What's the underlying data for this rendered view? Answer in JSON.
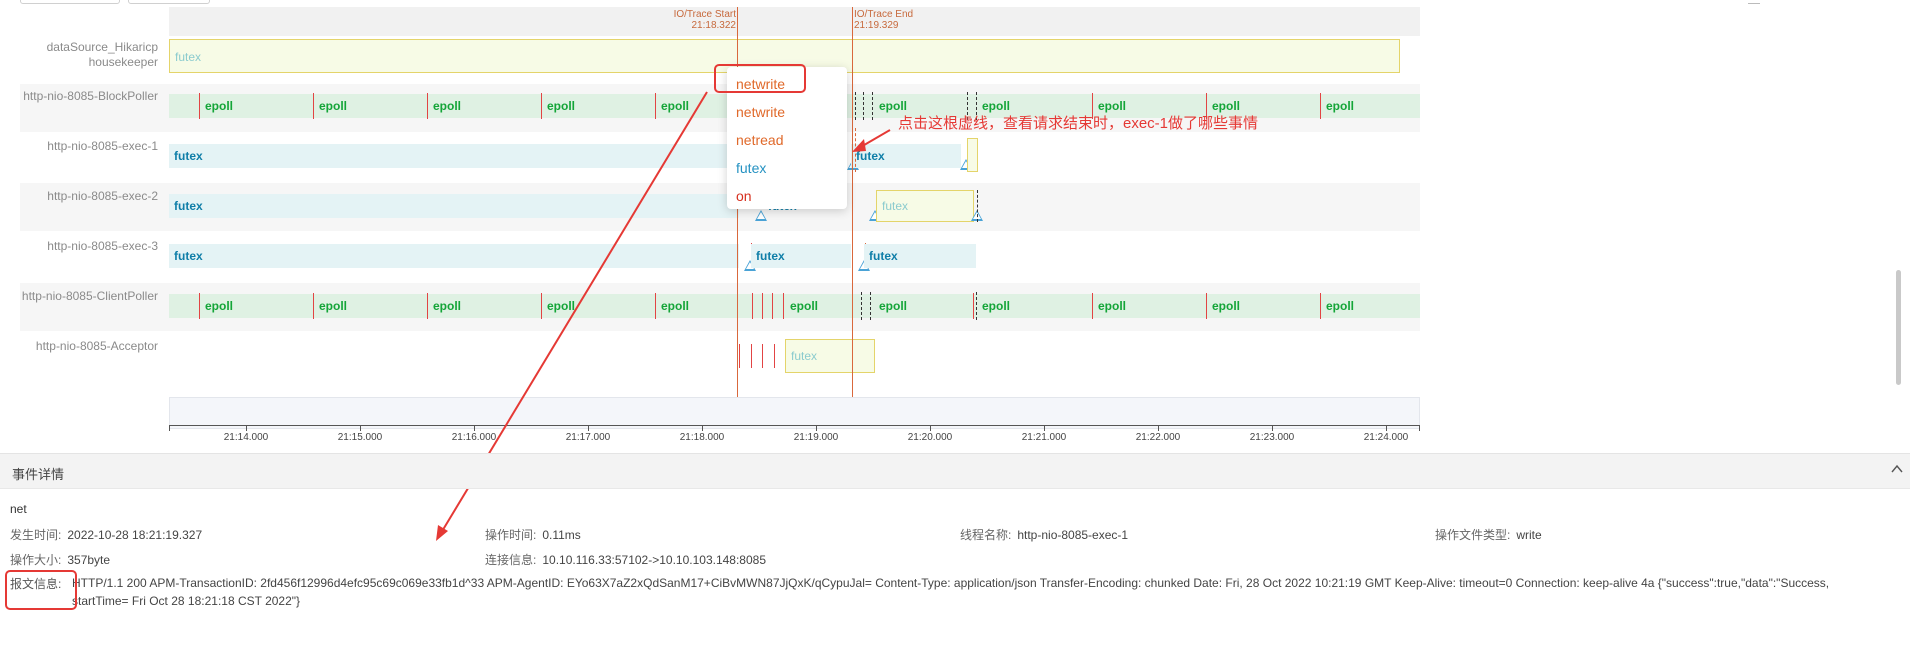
{
  "trace": {
    "start_label": "IO/Trace Start",
    "start_time": "21:18.322",
    "end_label": "IO/Trace End",
    "end_time": "21:19.329"
  },
  "rows": [
    {
      "label": "dataSource_Hikaricp housekeeper",
      "bar_text": "futex"
    },
    {
      "label": "http-nio-8085-BlockPoller",
      "bar_text": "epoll"
    },
    {
      "label": "http-nio-8085-exec-1",
      "bar_text": "futex"
    },
    {
      "label": "http-nio-8085-exec-2",
      "bar_text": "futex"
    },
    {
      "label": "http-nio-8085-exec-3",
      "bar_text": "futex"
    },
    {
      "label": "http-nio-8085-ClientPoller",
      "bar_text": "epoll"
    },
    {
      "label": "http-nio-8085-Acceptor",
      "bar_text": "futex"
    }
  ],
  "dropdown": {
    "items": [
      {
        "label": "netwrite",
        "color": "#e0692a"
      },
      {
        "label": "netwrite",
        "color": "#e0692a"
      },
      {
        "label": "netread",
        "color": "#e0692a"
      },
      {
        "label": "futex",
        "color": "#2592c2"
      },
      {
        "label": "on",
        "color": "#d62f1e"
      }
    ]
  },
  "annotation": "点击这根虚线，查看请求结束时，exec-1做了哪些事情",
  "axis_ticks": [
    "21:14.000",
    "21:15.000",
    "21:16.000",
    "21:17.000",
    "21:18.000",
    "21:19.000",
    "21:20.000",
    "21:21.000",
    "21:22.000",
    "21:23.000",
    "21:24.000"
  ],
  "details": {
    "title": "事件详情",
    "event_type": "net",
    "occur_time_label": "发生时间:",
    "occur_time": "2022-10-28 18:21:19.327",
    "op_time_label": "操作时间:",
    "op_time": "0.11ms",
    "thread_label": "线程名称:",
    "thread": "http-nio-8085-exec-1",
    "file_type_label": "操作文件类型:",
    "file_type": "write",
    "size_label": "操作大小:",
    "size": "357byte",
    "conn_label": "连接信息:",
    "conn": "10.10.116.33:57102->10.10.103.148:8085",
    "msg_label": "报文信息:",
    "msg": "HTTP/1.1 200 APM-TransactionID: 2fd456f12996d4efc95c69c069e33fb1d^33 APM-AgentID: EYo63X7aZ2xQdSanM17+CiBvMWN87JjQxK/qCypuJal= Content-Type: application/json Transfer-Encoding: chunked Date: Fri, 28 Oct 2022 10:21:19 GMT Keep-Alive: timeout=0 Connection: keep-alive 4a {\"success\":true,\"data\":\"Success, startTime= Fri Oct 28 18:21:18 CST 2022\"}"
  },
  "colors": {
    "accent_red": "#e53935",
    "green_bar": "#dff1e3",
    "blue_bar": "#e4f3f5",
    "trace_line": "#d9683c"
  }
}
